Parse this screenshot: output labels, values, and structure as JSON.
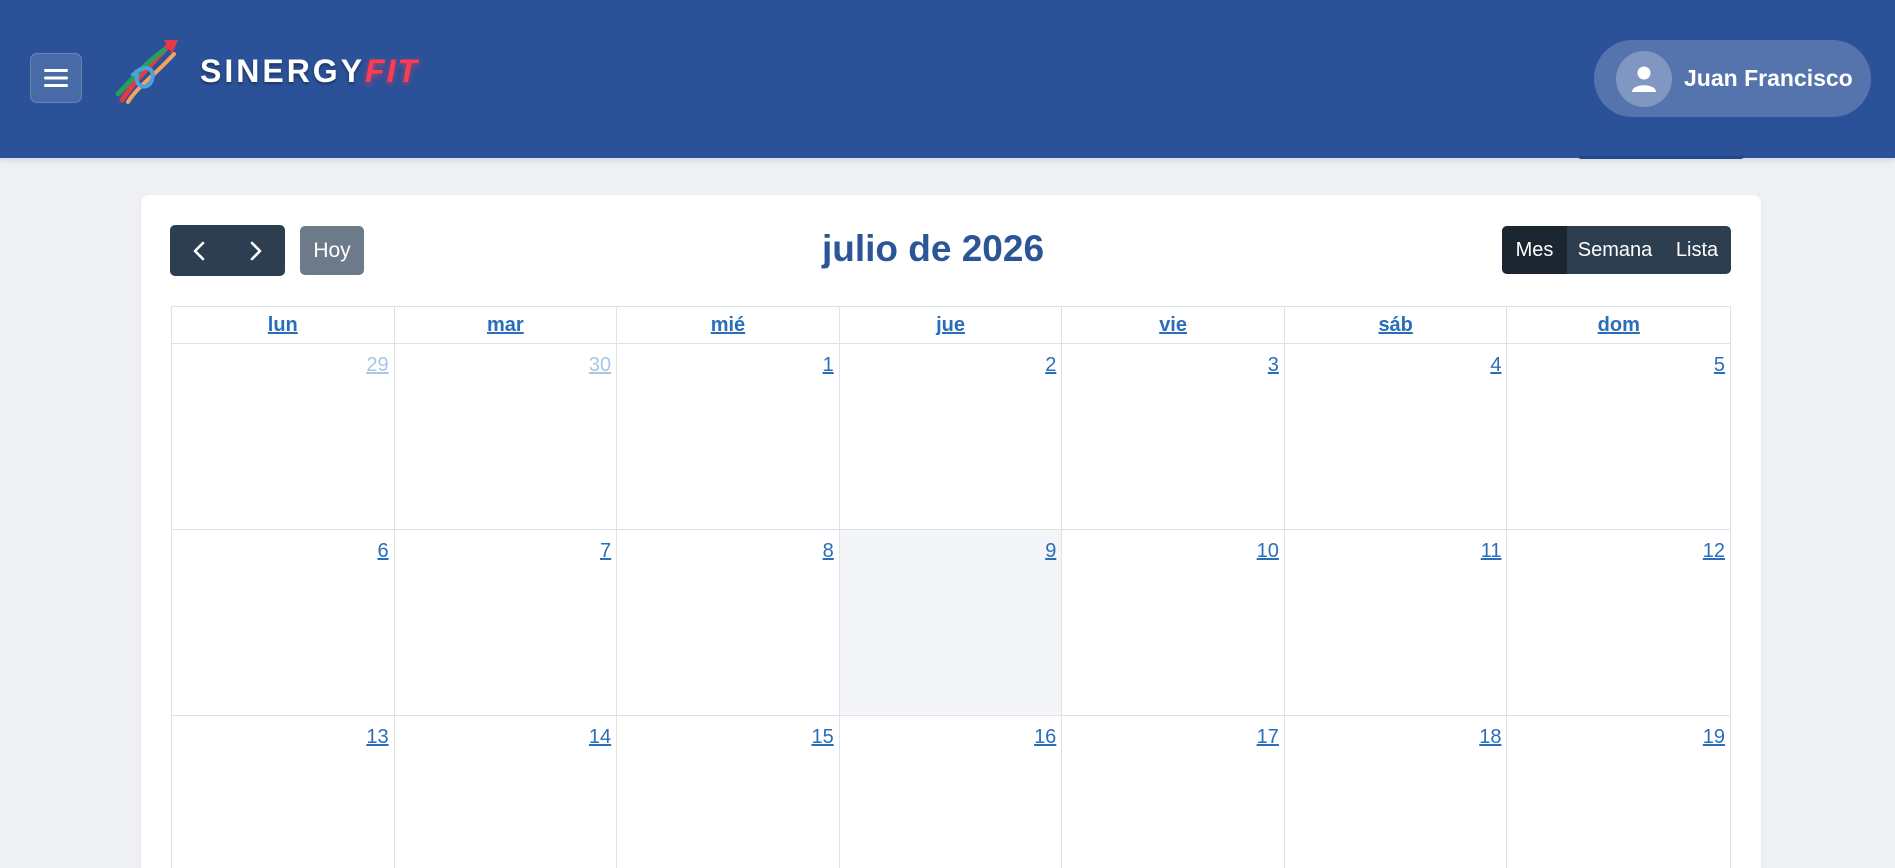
{
  "header": {
    "brand_main": "SINERGY",
    "brand_accent": "FIT",
    "menu_icon": "hamburger-menu-icon",
    "user_name": "Juan Francisco",
    "colors": {
      "bar": "#2b5299",
      "accent": "#ff3b52"
    }
  },
  "toolbar": {
    "prev_icon": "chevron-left-icon",
    "next_icon": "chevron-right-icon",
    "today_label": "Hoy",
    "title": "julio de 2026",
    "views": [
      {
        "label": "Mes",
        "active": true
      },
      {
        "label": "Semana",
        "active": false
      },
      {
        "label": "Lista",
        "active": false
      }
    ]
  },
  "calendar": {
    "weekdays": [
      "lun",
      "mar",
      "mié",
      "jue",
      "vie",
      "sáb",
      "dom"
    ],
    "weeks": [
      [
        {
          "day": "29",
          "other_month": true
        },
        {
          "day": "30",
          "other_month": true
        },
        {
          "day": "1"
        },
        {
          "day": "2"
        },
        {
          "day": "3"
        },
        {
          "day": "4"
        },
        {
          "day": "5"
        }
      ],
      [
        {
          "day": "6"
        },
        {
          "day": "7"
        },
        {
          "day": "8"
        },
        {
          "day": "9",
          "today": true
        },
        {
          "day": "10"
        },
        {
          "day": "11"
        },
        {
          "day": "12"
        }
      ],
      [
        {
          "day": "13"
        },
        {
          "day": "14"
        },
        {
          "day": "15"
        },
        {
          "day": "16"
        },
        {
          "day": "17"
        },
        {
          "day": "18"
        },
        {
          "day": "19"
        }
      ]
    ]
  }
}
